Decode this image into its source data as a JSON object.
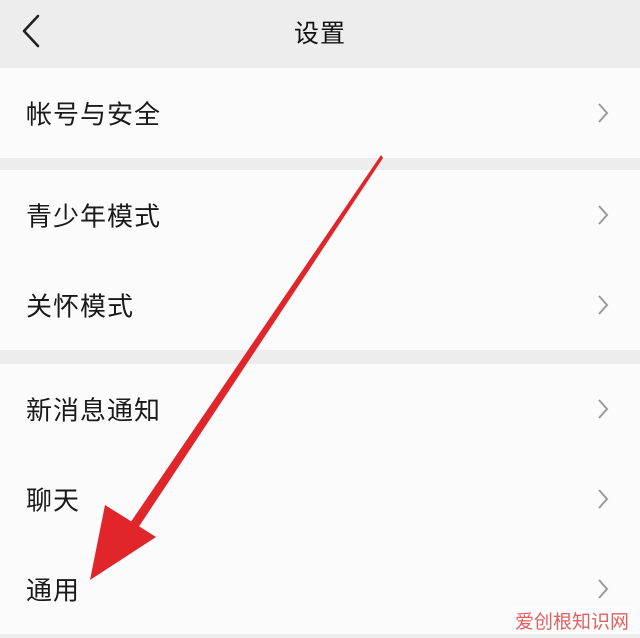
{
  "header": {
    "title": "设置",
    "back_icon": "chevron-left-icon"
  },
  "groups": [
    {
      "items": [
        {
          "label": "帐号与安全"
        }
      ]
    },
    {
      "items": [
        {
          "label": "青少年模式"
        },
        {
          "label": "关怀模式"
        }
      ]
    },
    {
      "items": [
        {
          "label": "新消息通知"
        },
        {
          "label": "聊天"
        },
        {
          "label": "通用"
        }
      ]
    }
  ],
  "row_icon": "chevron-right-icon",
  "annotation": {
    "arrow_color": "#e0252b",
    "target": "通用"
  },
  "watermark": "爱创根知识网",
  "colors": {
    "background": "#ededed",
    "card": "#fbfbfb",
    "text": "#1a1a1a",
    "chevron": "#9a9a9a"
  }
}
